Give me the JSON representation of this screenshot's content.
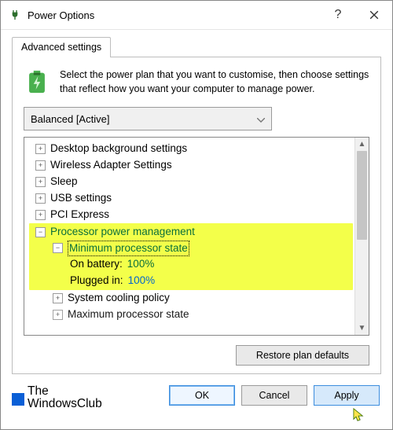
{
  "titlebar": {
    "title": "Power Options"
  },
  "tab": {
    "label": "Advanced settings"
  },
  "intro": "Select the power plan that you want to customise, then choose settings that reflect how you want your computer to manage power.",
  "plan_selected": "Balanced [Active]",
  "tree": {
    "desktop_bg": "Desktop background settings",
    "wireless": "Wireless Adapter Settings",
    "sleep": "Sleep",
    "usb": "USB settings",
    "pci": "PCI Express",
    "proc_mgmt": "Processor power management",
    "min_state": "Minimum processor state",
    "on_battery_label": "On battery:",
    "on_battery_val": "100%",
    "plugged_label": "Plugged in:",
    "plugged_val": "100%",
    "cooling": "System cooling policy",
    "max_state": "Maximum processor state"
  },
  "buttons": {
    "restore": "Restore plan defaults",
    "ok": "OK",
    "cancel": "Cancel",
    "apply": "Apply"
  },
  "brand": {
    "line1": "The",
    "line2": "WindowsClub"
  }
}
